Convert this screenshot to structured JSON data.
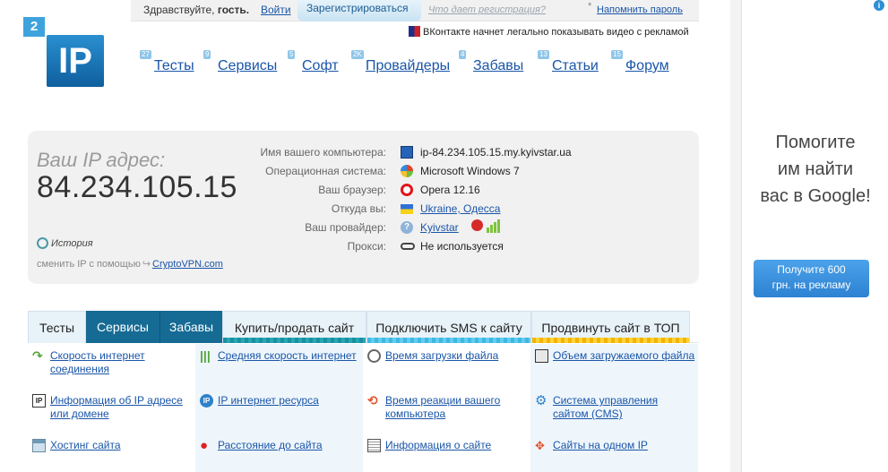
{
  "header": {
    "greeting_prefix": "Здравствуйте, ",
    "greeting_user": "гость.",
    "login_label": "Войти",
    "register_label": "Зарегистрироваться",
    "what_gives_label": "Что дает регистрация?",
    "star": "*",
    "remind_password_label": "Напомнить пароль",
    "news_text": "ВКонтакте начнет легально показывать видео с рекламой"
  },
  "logo": {
    "small": "2",
    "big": "IP"
  },
  "nav": [
    {
      "badge": "27",
      "label": "Тесты"
    },
    {
      "badge": "9",
      "label": "Сервисы"
    },
    {
      "badge": "5",
      "label": "Софт"
    },
    {
      "badge": "2K",
      "label": "Провайдеры"
    },
    {
      "badge": "4",
      "label": "Забавы"
    },
    {
      "badge": "13",
      "label": "Статьи"
    },
    {
      "badge": "15",
      "label": "Форум"
    }
  ],
  "ip_panel": {
    "caption": "Ваш IP адрес:",
    "ip": "84.234.105.15",
    "history_label": "История",
    "change_ip_prefix": "сменить IP с помощью",
    "vpn_label": "CryptoVPN.com",
    "rows": [
      {
        "key": "Имя вашего компьютера:",
        "value": "ip-84.234.105.15.my.kyivstar.ua",
        "icon": "computer-icon"
      },
      {
        "key": "Операционная система:",
        "value": "Microsoft Windows 7",
        "icon": "windows-icon"
      },
      {
        "key": "Ваш браузер:",
        "value": "Opera 12.16",
        "icon": "opera-icon"
      },
      {
        "key": "Откуда вы:",
        "value": "Ukraine, Одесса",
        "icon": "ukraine-flag-icon"
      },
      {
        "key": "Ваш провайдер:",
        "value": "Kyivstar",
        "icon": "help-icon"
      },
      {
        "key": "Прокси:",
        "value": "Не используется",
        "icon": "glasses-icon"
      }
    ]
  },
  "tabs": [
    {
      "label": "Тесты",
      "state": "plain"
    },
    {
      "label": "Сервисы",
      "state": "active"
    },
    {
      "label": "Забавы",
      "state": "active"
    },
    {
      "label": "Купить/продать сайт",
      "state": "plain",
      "stripe": "teal"
    },
    {
      "label": "Подключить SMS к сайту",
      "state": "plain",
      "stripe": "cyan"
    },
    {
      "label": "Продвинуть сайт в ТОП",
      "state": "plain",
      "stripe": "yellow"
    }
  ],
  "services": [
    [
      {
        "label": "Скорость интернет соединения",
        "icon": "speed-arrow-icon"
      },
      {
        "label": "Информация об IP адресе или домене",
        "icon": "ip-box-icon"
      },
      {
        "label": "Хостинг сайта",
        "icon": "table-icon"
      }
    ],
    [
      {
        "label": "Средняя скорость интернет",
        "icon": "bars-icon"
      },
      {
        "label": "IP интернет ресурса",
        "icon": "ip-circle-icon"
      },
      {
        "label": "Расстояние до сайта",
        "icon": "pin-icon"
      }
    ],
    [
      {
        "label": "Время загрузки файла",
        "icon": "clock-icon"
      },
      {
        "label": "Время реакции вашего компьютера",
        "icon": "reaction-icon"
      },
      {
        "label": "Информация о сайте",
        "icon": "document-icon"
      }
    ],
    [
      {
        "label": "Объем загружаемого файла",
        "icon": "frame-icon"
      },
      {
        "label": "Система управления сайтом (CMS)",
        "icon": "gear-icon"
      },
      {
        "label": "Сайты на одном IP",
        "icon": "network-icon"
      }
    ]
  ],
  "ad": {
    "info": "i",
    "headline_1": "Помогите",
    "headline_2": "им найти",
    "headline_3": "вас в Google!",
    "button_line_1": "Получите 600",
    "button_line_2": "грн. на рекламу"
  }
}
